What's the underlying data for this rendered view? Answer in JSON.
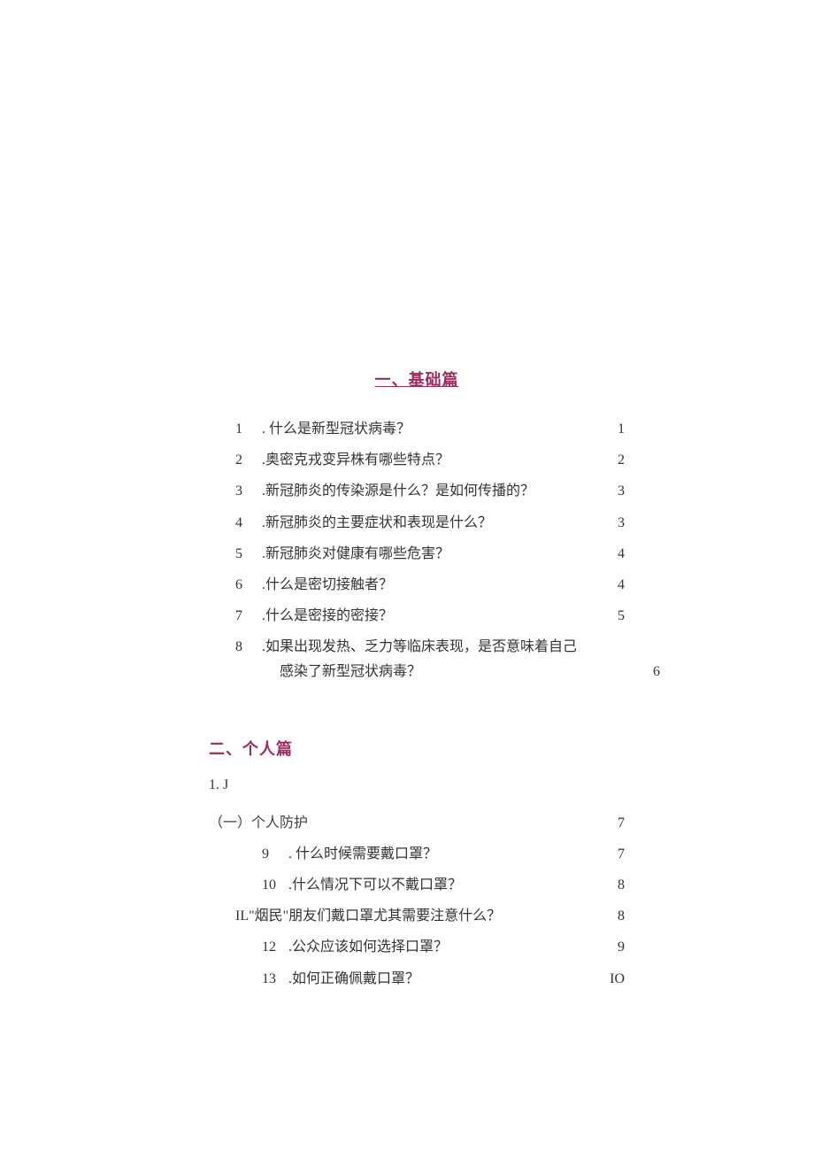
{
  "section1": {
    "title": "一、基础篇",
    "items": [
      {
        "num": "1",
        "text": ". 什么是新型冠状病毒？",
        "page": "1"
      },
      {
        "num": "2",
        "text": ".奥密克戎变异株有哪些特点？",
        "page": "2"
      },
      {
        "num": "3",
        "text": ".新冠肺炎的传染源是什么？是如何传播的？",
        "page": "3"
      },
      {
        "num": "4",
        "text": ".新冠肺炎的主要症状和表现是什么？",
        "page": "3"
      },
      {
        "num": "5",
        "text": ".新冠肺炎对健康有哪些危害？",
        "page": "4"
      },
      {
        "num": "6",
        "text": ".什么是密切接触者？",
        "page": "4"
      },
      {
        "num": "7",
        "text": ".什么是密接的密接？",
        "page": "5"
      },
      {
        "num": "8",
        "text": ".如果出现发热、乏力等临床表现，是否意味着自己",
        "cont": "感染了新型冠状病毒？",
        "page": "6"
      }
    ]
  },
  "section2": {
    "title": "二、个人篇",
    "sublabel": "1. J",
    "subsection": "（一）个人防护",
    "subsection_page": "7",
    "items": [
      {
        "num": "9",
        "text": ". 什么时候需要戴口罩？",
        "page": "7"
      },
      {
        "num": "10",
        "text": ".什么情况下可以不戴口罩？",
        "page": "8"
      },
      {
        "special": true,
        "text": "IL\"烟民\"朋友们戴口罩尤其需要注意什么？",
        "page": "8"
      },
      {
        "num": "12",
        "text": ".公众应该如何选择口罩？",
        "page": "9"
      },
      {
        "num": "13",
        "text": ".如何正确佩戴口罩？",
        "page": "IO"
      }
    ]
  }
}
